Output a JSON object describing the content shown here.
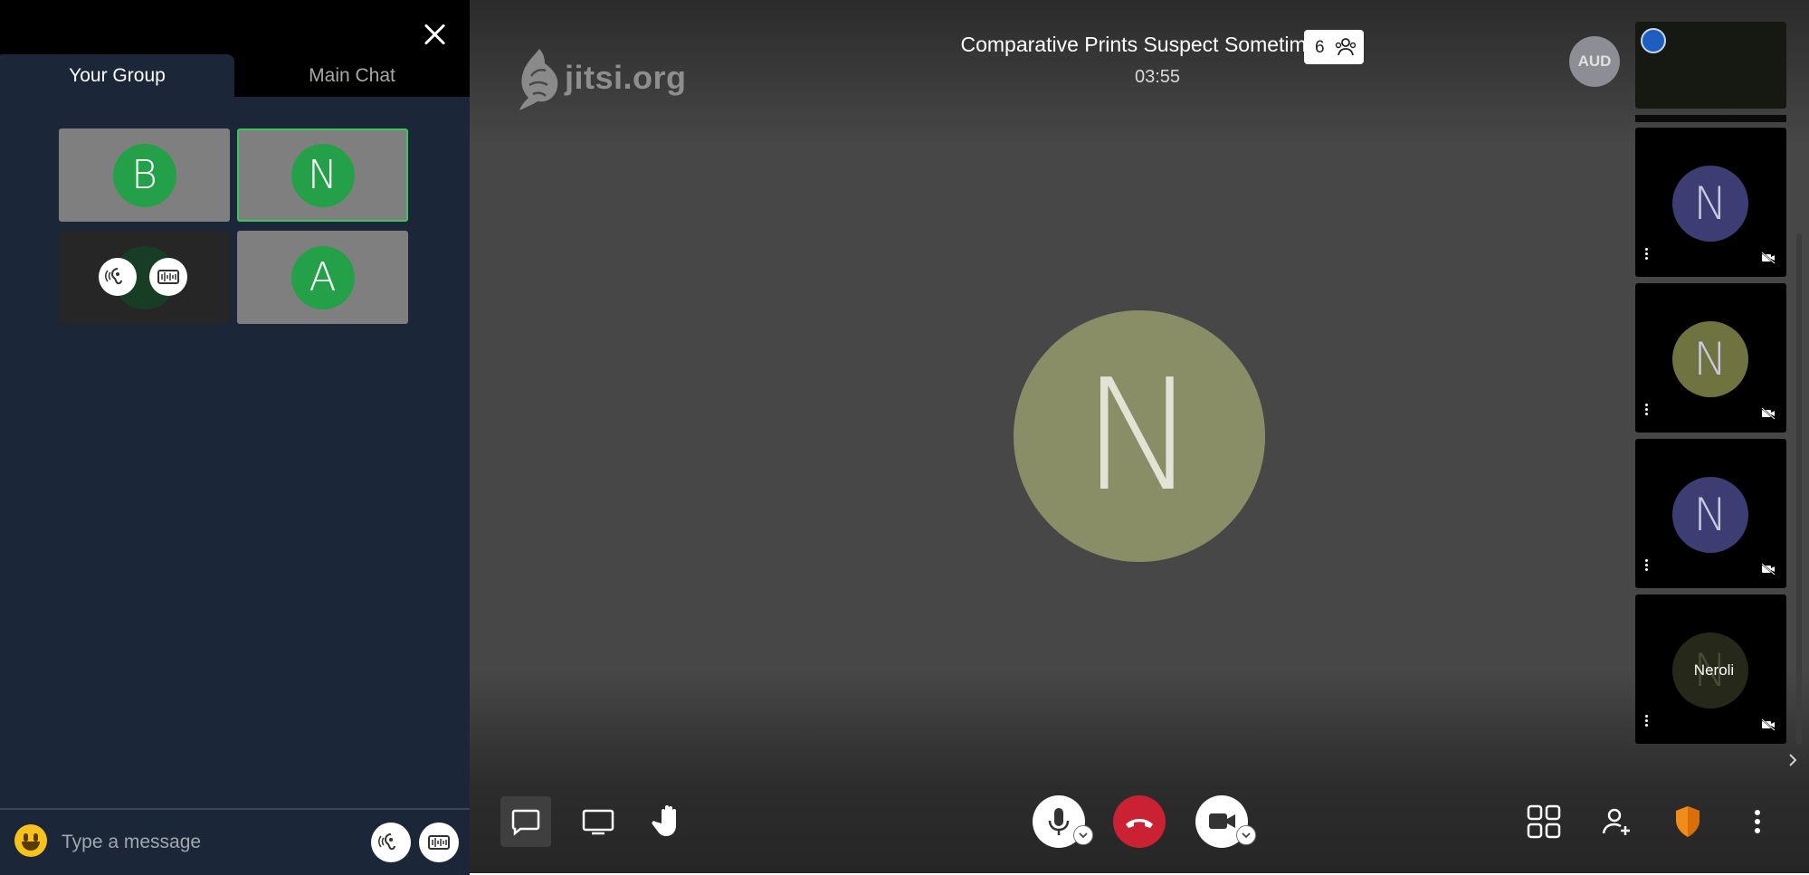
{
  "chat_panel": {
    "tabs": [
      {
        "label": "Your Group",
        "active": true
      },
      {
        "label": "Main Chat",
        "active": false
      }
    ],
    "group_tiles": [
      {
        "initial": "B",
        "selected": false
      },
      {
        "initial": "N",
        "selected": true
      },
      {
        "initial": "",
        "selected": false
      },
      {
        "initial": "A",
        "selected": false
      }
    ],
    "input_placeholder": "Type a message"
  },
  "header": {
    "logo_text": "jitsi.org",
    "meeting_title": "Comparative Prints Suspect Sometime",
    "participant_count": "6",
    "timer": "03:55",
    "self_avatar": "AUD"
  },
  "stage": {
    "dominant_initial": "N",
    "dominant_color": "#8a8e66"
  },
  "filmstrip": [
    {
      "initial": "",
      "name": "",
      "color": "#161812"
    },
    {
      "initial": "N",
      "name": "",
      "color": "#3c3d72"
    },
    {
      "initial": "N",
      "name": "",
      "color": "#6e7340"
    },
    {
      "initial": "N",
      "name": "",
      "color": "#3c3d72"
    },
    {
      "initial": "N",
      "name": "Neroli",
      "color": "#26281a"
    }
  ],
  "toolbar": {
    "left": [
      "chat-icon",
      "screenshare-icon",
      "raise-hand-icon"
    ],
    "center": [
      "microphone-icon",
      "hangup-icon",
      "camera-icon"
    ],
    "right": [
      "tile-view-icon",
      "invite-icon",
      "security-shield-icon",
      "more-icon"
    ]
  }
}
